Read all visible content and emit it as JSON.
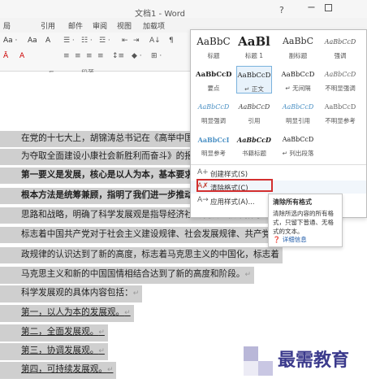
{
  "title_bar": {
    "title": "文档1 - Word",
    "help": "?",
    "minimize": "−"
  },
  "tabs": [
    "局",
    "引用",
    "邮件",
    "审阅",
    "视图",
    "加载项"
  ],
  "ribbon": {
    "font_size_label": "Aa ·",
    "font_buttons": [
      "A",
      "A",
      "Aa",
      "Ā"
    ],
    "para_group_label": "段落",
    "font_group_launcher": "⌐",
    "sort": "A↓",
    "pilcrow": "¶"
  },
  "styles_gallery": {
    "rows": [
      [
        {
          "preview": "AaBbC",
          "label": "标题"
        },
        {
          "preview": "AaBl",
          "label": "标题 1"
        },
        {
          "preview": "AaBbC",
          "label": "副标题"
        },
        {
          "preview": "AaBbCcD",
          "label": "强调"
        }
      ],
      [
        {
          "preview": "AaBbCcD",
          "label": "要点"
        },
        {
          "preview": "AaBbCcD",
          "label": "↵ 正文"
        },
        {
          "preview": "AaBbCcD",
          "label": "↵ 无间隔"
        },
        {
          "preview": "AaBbCcD",
          "label": "不明显强调"
        }
      ],
      [
        {
          "preview": "AaBbCcD",
          "label": "明显强调"
        },
        {
          "preview": "AaBbCcD",
          "label": "引用"
        },
        {
          "preview": "AaBbCcD",
          "label": "明显引用"
        },
        {
          "preview": "AaBbCcD",
          "label": "不明显参考"
        }
      ],
      [
        {
          "preview": "AaBbCcI",
          "label": "明显参考"
        },
        {
          "preview": "AaBbCcD",
          "label": "书籍标题"
        },
        {
          "preview": "AaBbCcD",
          "label": "↵ 列出段落"
        }
      ]
    ],
    "actions": [
      {
        "icon": "A+",
        "label": "创建样式(S)"
      },
      {
        "icon": "A✗",
        "label": "清除格式(C)"
      },
      {
        "icon": "A→",
        "label": "应用样式(A)..."
      }
    ]
  },
  "tooltip": {
    "title": "清除所有格式",
    "body": "清除所选内容的所有格式，只留下普通、无格式的文本。",
    "help": "详细信息"
  },
  "document": {
    "lines": [
      {
        "text": "在党的十七大上，胡锦涛总书记在《高举中国特",
        "pm": "",
        "sel": true,
        "bold": false,
        "u": false
      },
      {
        "text": "为夺取全面建设小康社会新胜利而奋斗》的报告",
        "pm": "",
        "sel": true,
        "bold": false,
        "u": false
      },
      {
        "text": "第一要义是发展，核心是以人为本，基本要求",
        "pm": "",
        "sel": true,
        "bold": true,
        "u": false
      },
      {
        "text": "根本方法是统筹兼顾，指明了我们进一步推动中国经济改革与发展",
        "pm": "",
        "sel": true,
        "bold": true,
        "u": false
      },
      {
        "text": "思路和战略，明确了科学发展观是指导经济社会发展的根本指导思",
        "pm": "",
        "sel": true,
        "bold": false,
        "u": false
      },
      {
        "text": "标志着中国共产党对于社会主义建设规律、社会发展规律、共产党执",
        "pm": "",
        "sel": true,
        "bold": false,
        "u": false
      },
      {
        "text": "政规律的认识达到了新的高度，标志着马克思主义的中国化，标志着",
        "pm": "",
        "sel": true,
        "bold": false,
        "u": false
      },
      {
        "text": "马克思主义和新的中国国情相结合达到了新的高度和阶段。",
        "pm": "↵",
        "sel": true,
        "bold": false,
        "u": false
      },
      {
        "text": "科学发展观的具体内容包括：",
        "pm": "↵",
        "sel": true,
        "bold": false,
        "u": false
      },
      {
        "text": "第一，以人为本的发展观。",
        "pm": "↵",
        "sel": true,
        "bold": false,
        "u": true
      },
      {
        "text": "第二，全面发展观。",
        "pm": "↵",
        "sel": true,
        "bold": false,
        "u": true
      },
      {
        "text": "第三，协调发展观。",
        "pm": "↵",
        "sel": true,
        "bold": false,
        "u": true
      },
      {
        "text": "第四，可持续发展观。",
        "pm": "↵",
        "sel": true,
        "bold": false,
        "u": true
      }
    ]
  },
  "watermark": {
    "text": "最需教育"
  },
  "colors": {
    "selection": "#cfcfcf",
    "highlight_box": "#d32f2f",
    "help_link": "#1e5aa8"
  }
}
